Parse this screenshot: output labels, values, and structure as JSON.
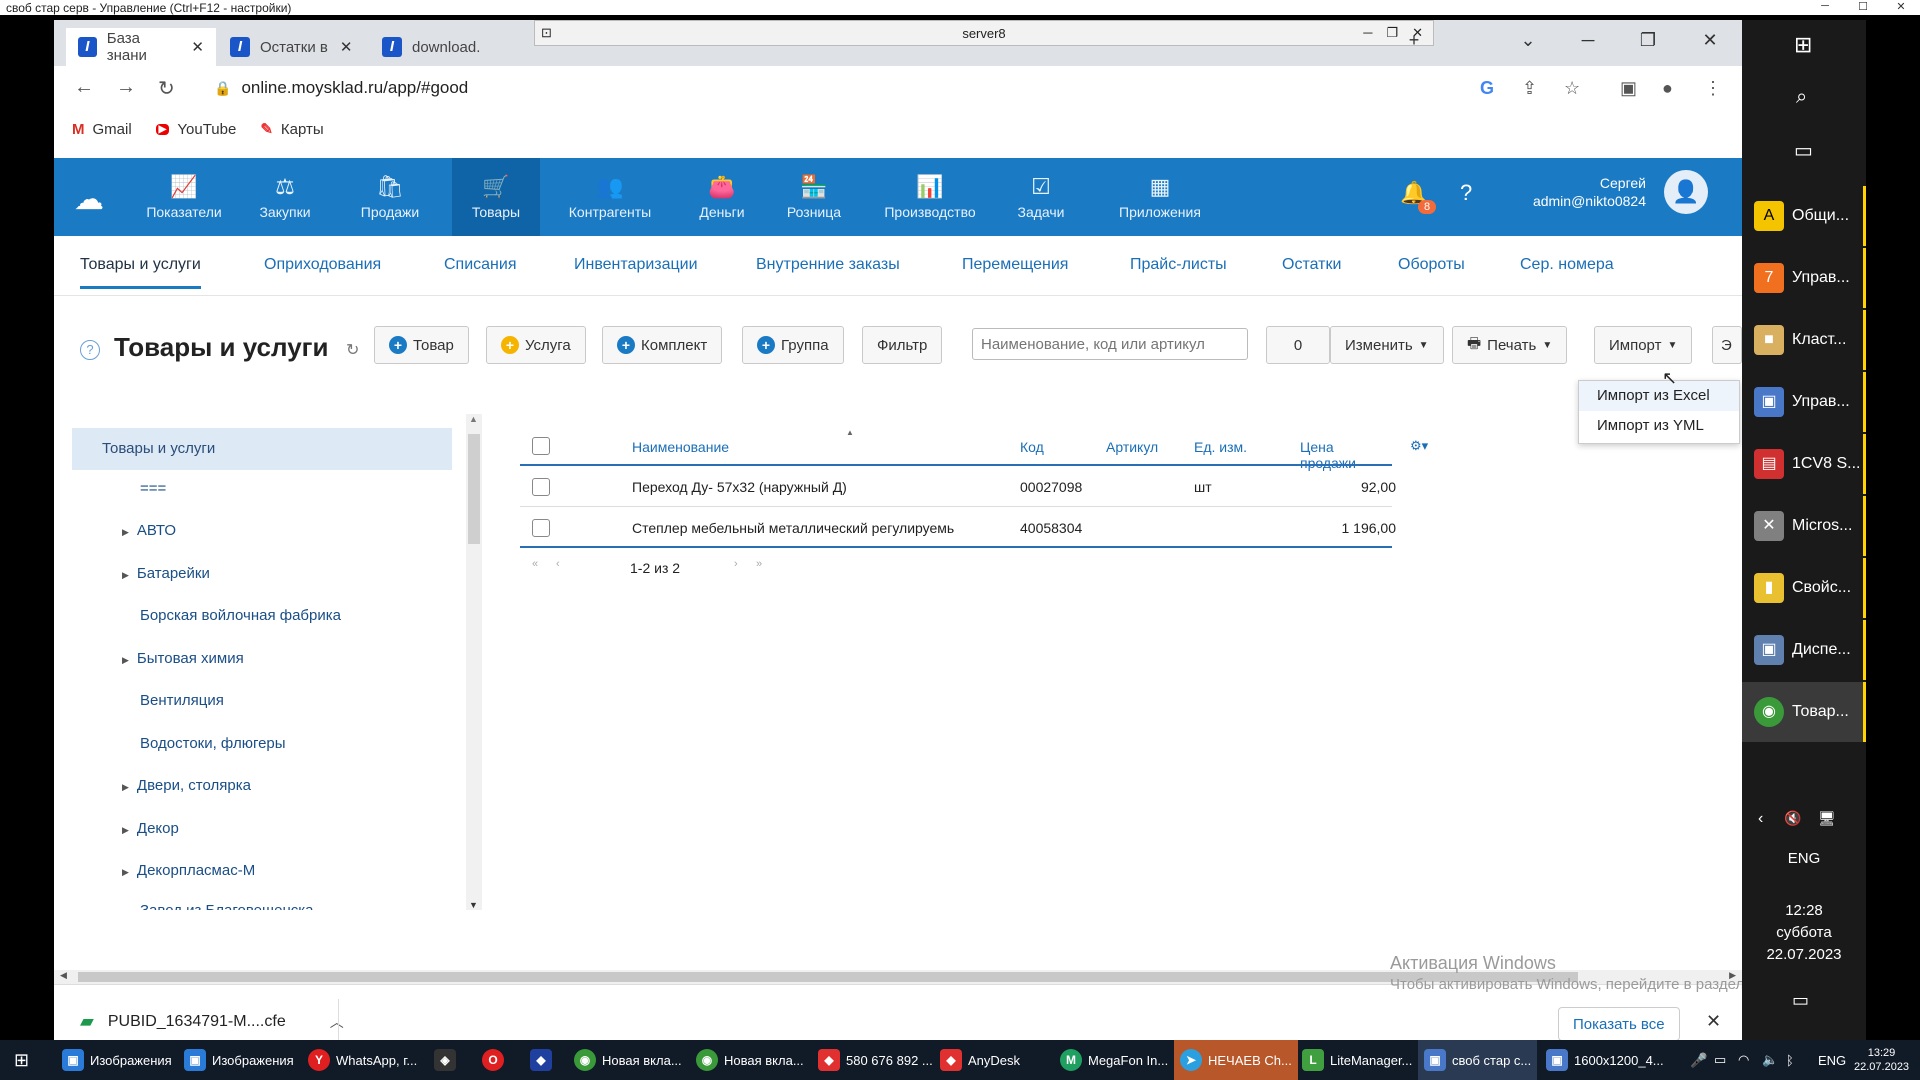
{
  "remote_title": "своб стар серв - Управление     (Ctrl+F12 - настройки)",
  "server_bar": "server8",
  "browser_tabs": [
    {
      "label": "База знани"
    },
    {
      "label": "Остатки в"
    },
    {
      "label": "download."
    }
  ],
  "url": "online.moysklad.ru/app/#good",
  "bookmarks": [
    {
      "label": "Gmail",
      "icon": "M"
    },
    {
      "label": "YouTube",
      "icon": "▶"
    },
    {
      "label": "Карты",
      "icon": "✎"
    }
  ],
  "ms_nav": [
    {
      "label": "Показатели",
      "icon": "📈"
    },
    {
      "label": "Закупки",
      "icon": "⚖"
    },
    {
      "label": "Продажи",
      "icon": "🛍"
    },
    {
      "label": "Товары",
      "icon": "🛒"
    },
    {
      "label": "Контрагенты",
      "icon": "👥"
    },
    {
      "label": "Деньги",
      "icon": "👛"
    },
    {
      "label": "Розница",
      "icon": "🏪"
    },
    {
      "label": "Производство",
      "icon": "📊"
    },
    {
      "label": "Задачи",
      "icon": "☑"
    },
    {
      "label": "Приложения",
      "icon": "▦"
    }
  ],
  "notifications_count": "8",
  "user": {
    "name": "Сергей",
    "login": "admin@nikto0824"
  },
  "subnav": [
    "Товары и услуги",
    "Оприходования",
    "Списания",
    "Инвентаризации",
    "Внутренние заказы",
    "Перемещения",
    "Прайс-листы",
    "Остатки",
    "Обороты",
    "Сер. номера"
  ],
  "page_title": "Товары и услуги",
  "toolbar": {
    "product": "Товар",
    "service": "Услуга",
    "bundle": "Комплект",
    "group": "Группа",
    "filter": "Фильтр",
    "search_placeholder": "Наименование, код или артикул",
    "selected_count": "0",
    "edit": "Изменить",
    "print": "Печать",
    "import": "Импорт",
    "export_partial": "Э"
  },
  "import_menu": [
    "Импорт из Excel",
    "Импорт из YML"
  ],
  "tree": {
    "root": "Товары и услуги",
    "items": [
      {
        "label": "===",
        "caret": false
      },
      {
        "label": "АВТО",
        "caret": true
      },
      {
        "label": "Батарейки",
        "caret": true
      },
      {
        "label": "Борская войлочная фабрика",
        "caret": false
      },
      {
        "label": "Бытовая химия",
        "caret": true
      },
      {
        "label": "Вентиляция",
        "caret": false
      },
      {
        "label": "Водостоки, флюгеры",
        "caret": false
      },
      {
        "label": "Двери, столярка",
        "caret": true
      },
      {
        "label": "Декор",
        "caret": true
      },
      {
        "label": "Декорпласмас-М",
        "caret": true
      },
      {
        "label": "Завод из Благовещенска",
        "caret": false
      }
    ]
  },
  "table": {
    "columns": [
      "Наименование",
      "Код",
      "Артикул",
      "Ед. изм.",
      "Цена продажи"
    ],
    "rows": [
      {
        "name": "Переход Ду- 57х32 (наружный Д)",
        "code": "00027098",
        "article": "",
        "unit": "шт",
        "price": "92,00"
      },
      {
        "name": "Степлер мебельный металлический регулируемь",
        "code": "40058304",
        "article": "",
        "unit": "",
        "price": "1 196,00"
      }
    ],
    "pagination": "1-2 из 2"
  },
  "download": {
    "file": "PUBID_1634791-M....cfe",
    "show_all": "Показать все"
  },
  "activation": {
    "title": "Активация Windows",
    "text": "Чтобы активировать Windows, перейдите в раздел \"Параметры\"."
  },
  "right_panel": {
    "items": [
      {
        "label": "Общи...",
        "icon": "A",
        "color": "#f5c400"
      },
      {
        "label": "Управ...",
        "icon": "7",
        "color": "#f07020"
      },
      {
        "label": "Класт...",
        "icon": "■",
        "color": "#d8b060"
      },
      {
        "label": "Управ...",
        "icon": "▣",
        "color": "#4a78c8"
      },
      {
        "label": "1CV8 S...",
        "icon": "▤",
        "color": "#d03030"
      },
      {
        "label": "Micros...",
        "icon": "✕",
        "color": "#808080"
      },
      {
        "label": "Свойс...",
        "icon": "▮",
        "color": "#e8c030"
      },
      {
        "label": "Диспе...",
        "icon": "▣",
        "color": "#6080b0"
      },
      {
        "label": "Товар...",
        "icon": "◉",
        "color": "#3a9a3a"
      }
    ],
    "lang": "ENG",
    "time": "12:28",
    "weekday": "суббота",
    "date": "22.07.2023"
  },
  "taskbar": {
    "items": [
      {
        "label": "Изображения",
        "icon": "▣",
        "color": "#2a7ad8"
      },
      {
        "label": "Изображения",
        "icon": "▣",
        "color": "#2a7ad8"
      },
      {
        "label": "WhatsApp, г...",
        "icon": "Y",
        "color": "#e02020"
      },
      {
        "label": "",
        "icon": "◈",
        "color": "#333"
      },
      {
        "label": "",
        "icon": "O",
        "color": "#e02020"
      },
      {
        "label": "",
        "icon": "◆",
        "color": "#2040a0"
      },
      {
        "label": "Новая вкла...",
        "icon": "◉",
        "color": "#3a9a3a"
      },
      {
        "label": "Новая вкла...",
        "icon": "◉",
        "color": "#3a9a3a"
      },
      {
        "label": "580 676 892 ...",
        "icon": "◆",
        "color": "#e03030"
      },
      {
        "label": "AnyDesk",
        "icon": "◆",
        "color": "#e03030"
      },
      {
        "label": "MegaFon In...",
        "icon": "M",
        "color": "#20a060"
      },
      {
        "label": "НЕЧАЕВ Ch...",
        "icon": "➤",
        "color": "#2aa0e0"
      },
      {
        "label": "LiteManager...",
        "icon": "L",
        "color": "#40a040"
      },
      {
        "label": "своб стар с...",
        "icon": "▣",
        "color": "#4a78c8"
      },
      {
        "label": "1600x1200_4...",
        "icon": "▣",
        "color": "#4a78c8"
      }
    ],
    "lang": "ENG",
    "time": "13:29",
    "date": "22.07.2023"
  }
}
